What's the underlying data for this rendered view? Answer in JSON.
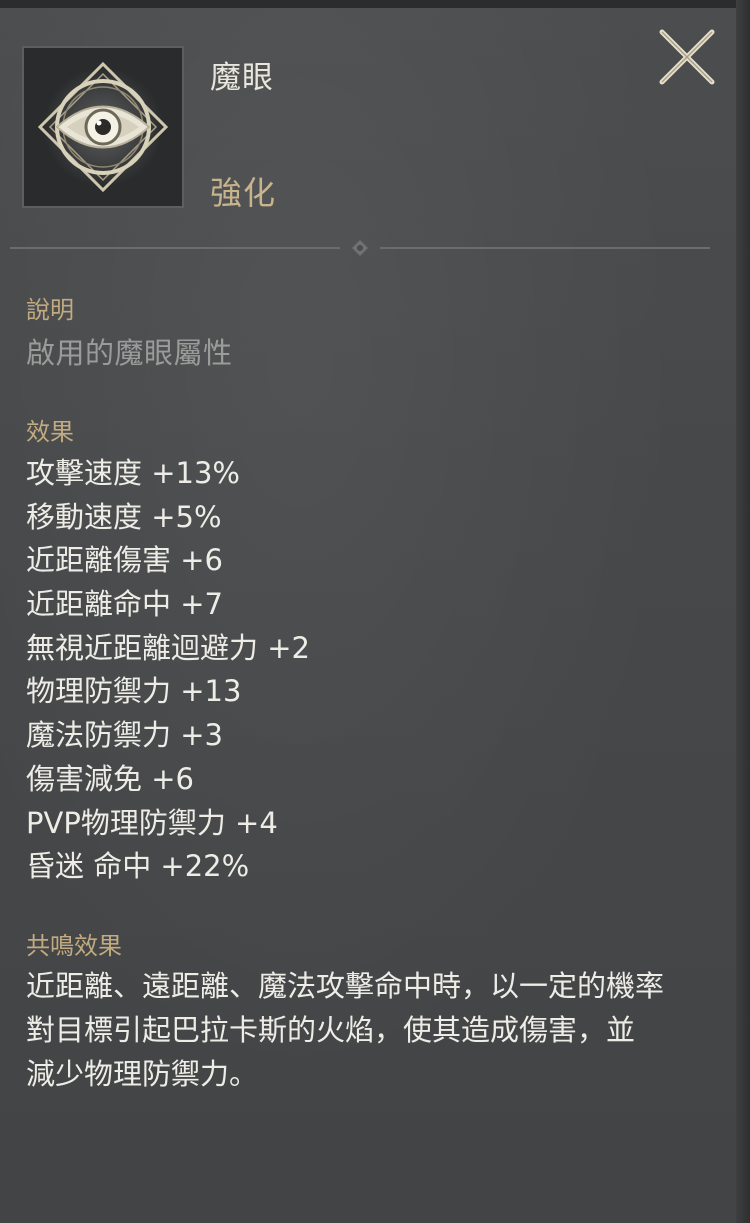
{
  "item": {
    "name": "魔眼",
    "type": "強化",
    "icon": "evil-eye-icon"
  },
  "close": {
    "icon": "close-x-icon"
  },
  "description": {
    "label": "說明",
    "text": "啟用的魔眼屬性"
  },
  "effects": {
    "label": "效果",
    "lines": [
      "攻擊速度 +13%",
      "移動速度 +5%",
      "近距離傷害 +6",
      "近距離命中 +7",
      "無視近距離迴避力 +2",
      "物理防禦力 +13",
      "魔法防禦力 +3",
      "傷害減免 +6",
      "PVP物理防禦力 +4",
      "昏迷 命中 +22%"
    ]
  },
  "resonance": {
    "label": "共鳴效果",
    "lines": [
      "近距離、遠距離、魔法攻擊命中時，以一定的機率",
      "對目標引起巴拉卡斯的火焰，使其造成傷害，並",
      "減少物理防禦力。"
    ]
  },
  "colors": {
    "panel_bg": "#46484a",
    "accent_gold": "#c2ab80",
    "text_primary": "#eeece6",
    "text_muted": "#9b9b99"
  }
}
